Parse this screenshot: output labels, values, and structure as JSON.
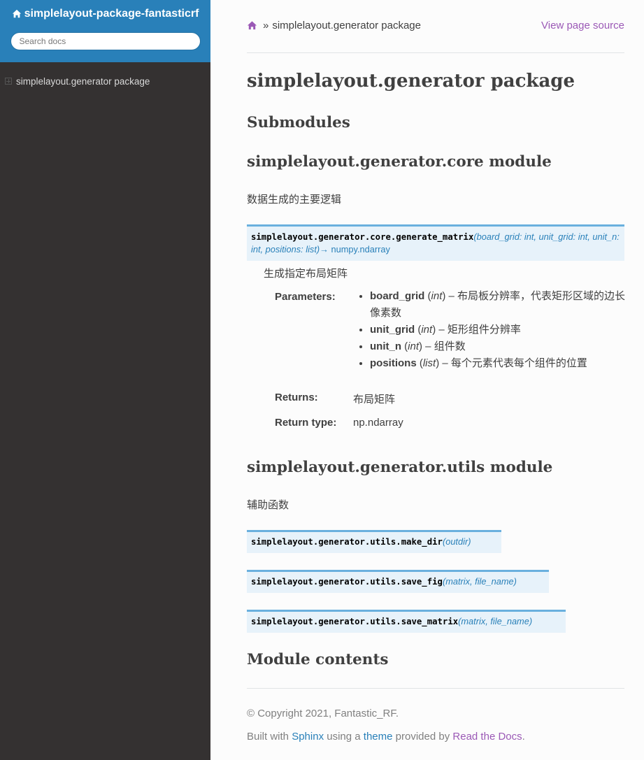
{
  "sidebar": {
    "project_name": "simplelayout-package-fantasticrf",
    "search_placeholder": "Search docs",
    "toc": [
      {
        "label": "simplelayout.generator package"
      }
    ]
  },
  "breadcrumbs": {
    "current": "simplelayout.generator package",
    "separator": "»",
    "view_source": "View page source"
  },
  "content": {
    "title": "simplelayout.generator package",
    "submodules_heading": "Submodules",
    "core_heading": "simplelayout.generator.core module",
    "core_desc": "数据生成的主要逻辑",
    "generate_matrix": {
      "name": "simplelayout.generator.core.generate_matrix",
      "params": "(board_grid: int, unit_grid: int, unit_n: int, positions: list)",
      "returns": "→ numpy.ndarray",
      "desc": "生成指定布局矩阵",
      "parameters_label": "Parameters:",
      "parameters": [
        {
          "name": "board_grid",
          "type": "int",
          "desc": "布局板分辨率，代表矩形区域的边长像素数"
        },
        {
          "name": "unit_grid",
          "type": "int",
          "desc": "矩形组件分辨率"
        },
        {
          "name": "unit_n",
          "type": "int",
          "desc": "组件数"
        },
        {
          "name": "positions",
          "type": "list",
          "desc": "每个元素代表每个组件的位置"
        }
      ],
      "returns_label": "Returns:",
      "returns_value": "布局矩阵",
      "return_type_label": "Return type:",
      "return_type_value": "np.ndarray"
    },
    "utils_heading": "simplelayout.generator.utils module",
    "utils_desc": "辅助函数",
    "make_dir": {
      "name": "simplelayout.generator.utils.make_dir",
      "params": "(outdir)"
    },
    "save_fig": {
      "name": "simplelayout.generator.utils.save_fig",
      "params": "(matrix, file_name)"
    },
    "save_matrix": {
      "name": "simplelayout.generator.utils.save_matrix",
      "params": "(matrix, file_name)"
    },
    "module_contents_heading": "Module contents"
  },
  "footer": {
    "copyright": "© Copyright 2021, Fantastic_RF.",
    "built_with": "Built with",
    "sphinx": "Sphinx",
    "using_a": "using a",
    "theme": "theme",
    "provided_by": "provided by",
    "rtd": "Read the Docs",
    "period": "."
  },
  "colors": {
    "sidebar_top": "#2980b9",
    "sidebar_bg": "#343131",
    "link_purple": "#9b59b6",
    "link_blue": "#2980b9",
    "sig_bg": "#e7f2fa",
    "sig_border": "#6ab0de"
  },
  "icons": {
    "home": "home-icon",
    "expand": "expand-plus-icon"
  }
}
